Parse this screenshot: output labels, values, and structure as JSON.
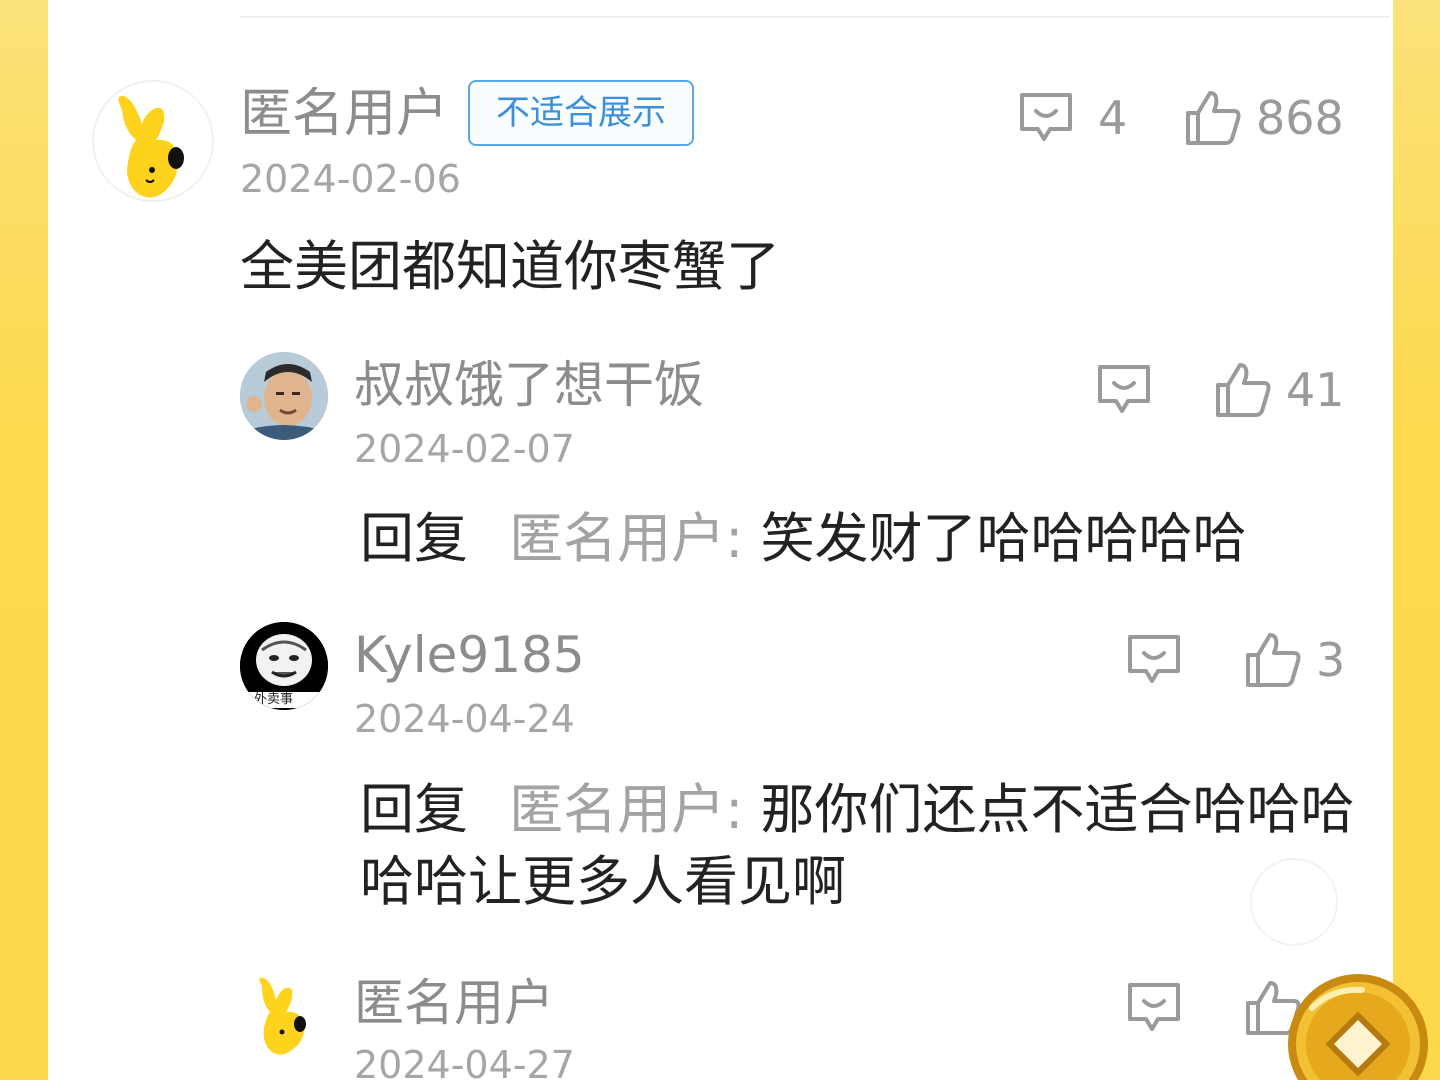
{
  "comments": [
    {
      "username": "匿名用户",
      "tag": "不适合展示",
      "date": "2024-02-06",
      "content": "全美团都知道你枣蟹了",
      "reply_count": "4",
      "like_count": "868",
      "avatar": "yellow-mascot-avatar"
    }
  ],
  "replies": [
    {
      "username": "叔叔饿了想干饭",
      "date": "2024-02-07",
      "reply_prefix": "回复",
      "reply_target": "匿名用户:",
      "content": "笑发财了哈哈哈哈哈",
      "like_count": "41",
      "avatar": "man-photo-avatar"
    },
    {
      "username": "Kyle9185",
      "date": "2024-04-24",
      "reply_prefix": "回复",
      "reply_target": "匿名用户:",
      "content": "那你们还点不适合哈哈哈哈哈让更多人看见啊",
      "like_count": "3",
      "avatar": "meme-face-avatar",
      "avatar_caption": "外卖事"
    },
    {
      "username": "匿名用户",
      "date": "2024-04-27",
      "avatar": "yellow-mascot-avatar"
    }
  ],
  "icons": {
    "comment": "comment-bubble-icon",
    "like": "thumbs-up-icon",
    "coin": "gold-coin-icon"
  },
  "colors": {
    "background": "#fcd84a",
    "tag_border": "#5aa7e6",
    "tag_text": "#3d8fd6",
    "muted_text": "#8c8c8c"
  }
}
